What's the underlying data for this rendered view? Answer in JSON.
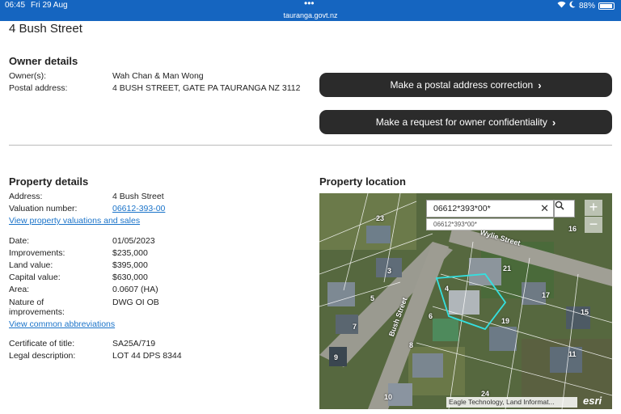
{
  "status_bar": {
    "time": "06:45",
    "date": "Fri 29 Aug",
    "url": "tauranga.govt.nz",
    "battery": "88%",
    "dots": "•••"
  },
  "page": {
    "title": "4 Bush Street"
  },
  "owner": {
    "heading": "Owner details",
    "owners_label": "Owner(s):",
    "owners_value": "Wah Chan & Man Wong",
    "postal_label": "Postal address:",
    "postal_value": "4 BUSH STREET, GATE PA TAURANGA NZ 3112",
    "correction_button": "Make a postal address correction",
    "confidentiality_button": "Make a request for owner confidentiality"
  },
  "property": {
    "heading": "Property details",
    "address_label": "Address:",
    "address_value": "4 Bush Street",
    "valuation_label": "Valuation number:",
    "valuation_value": "06612-393-00",
    "valuations_link": "View property valuations and sales",
    "date_label": "Date:",
    "date_value": "01/05/2023",
    "improvements_label": "Improvements:",
    "improvements_value": "$235,000",
    "land_label": "Land value:",
    "land_value": "$395,000",
    "capital_label": "Capital value:",
    "capital_value": "$630,000",
    "area_label": "Area:",
    "area_value": "0.0607 (HA)",
    "nature_label_1": "Nature of",
    "nature_label_2": "improvements:",
    "nature_value": "DWG OI OB",
    "abbrev_link": "View common abbreviations",
    "cert_label": "Certificate of title:",
    "cert_value": "SA25A/719",
    "legal_label": "Legal description:",
    "legal_value": "LOT 44 DPS 8344"
  },
  "location": {
    "heading": "Property location",
    "search_value": "06612*393*00*",
    "suggestion": "06612*393*00*",
    "zoom_in": "+",
    "zoom_out": "−",
    "attribution": "Eagle Technology, Land Informat...",
    "esri": "esri",
    "streets": [
      "Wylie Street",
      "Bush Street"
    ],
    "parcel_numbers": [
      "23",
      "16",
      "3",
      "21",
      "4",
      "5",
      "17",
      "6",
      "19",
      "15",
      "7",
      "8",
      "11",
      "9",
      "24",
      "10"
    ]
  }
}
